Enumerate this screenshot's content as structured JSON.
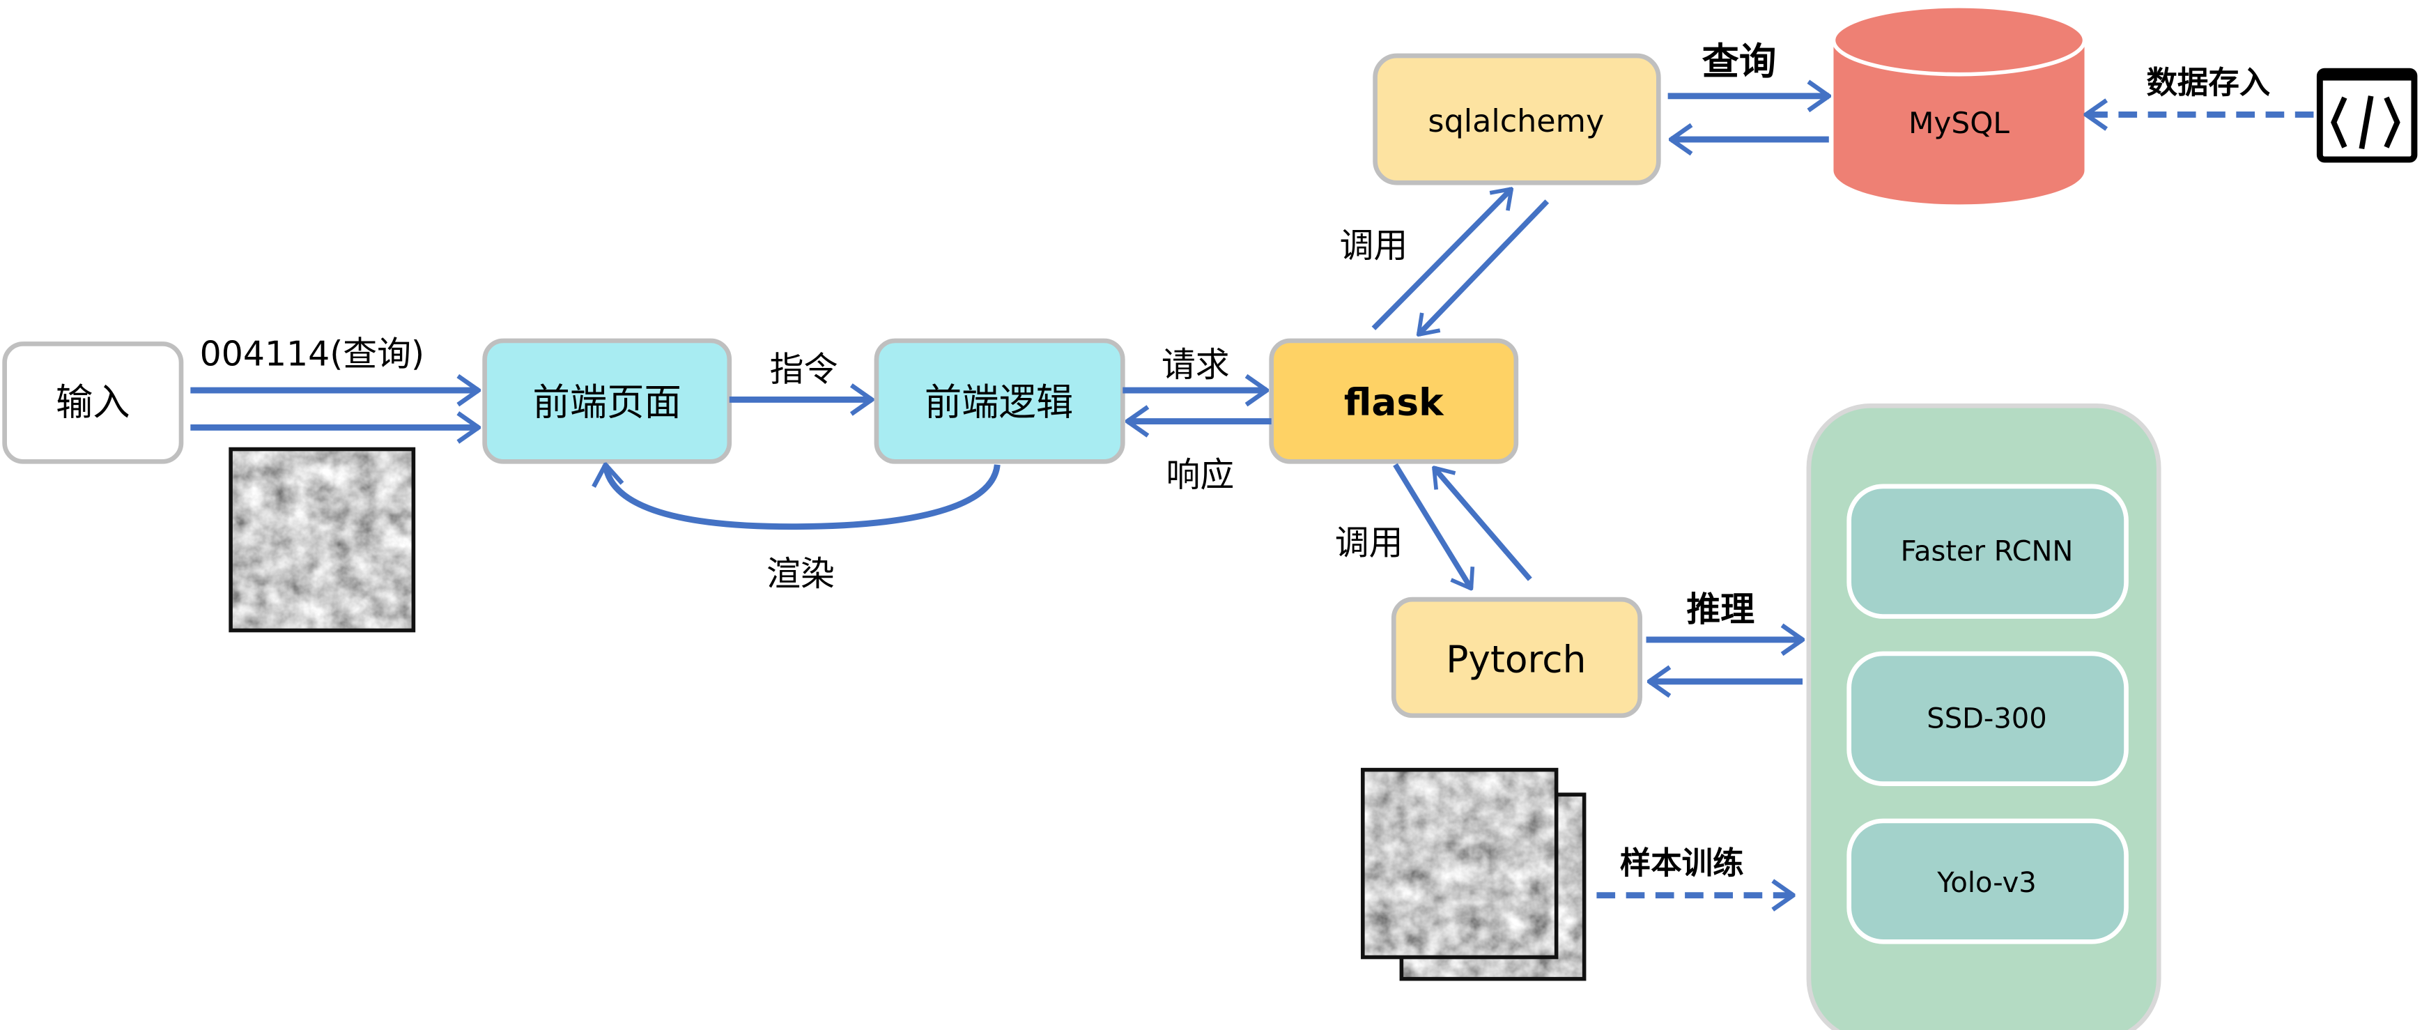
{
  "colors": {
    "arrow": "#4472c4",
    "frontend": "#a8ecf2",
    "flask": "#fed265",
    "orm": "#fde3a1",
    "mysql": "#ee8074",
    "model_panel": "#b4dbc3",
    "model_item": "#a3d2cb",
    "border": "#bfbfbf"
  },
  "nodes": {
    "input": "输入",
    "frontend_page": "前端页面",
    "frontend_logic": "前端逻辑",
    "flask": "flask",
    "sqlalchemy": "sqlalchemy",
    "mysql": "MySQL",
    "pytorch": "Pytorch",
    "models": [
      "Faster RCNN",
      "SSD-300",
      "Yolo-v3"
    ]
  },
  "edges": {
    "input_query": "004114(查询)",
    "command": "指令",
    "request": "请求",
    "response": "响应",
    "render": "渲染",
    "call_db": "调用",
    "call_model": "调用",
    "query": "查询",
    "data_store": "数据存入",
    "inference": "推理",
    "training": "样本训练"
  },
  "icons": {
    "code": "code-icon",
    "satellite": "satellite-image"
  }
}
